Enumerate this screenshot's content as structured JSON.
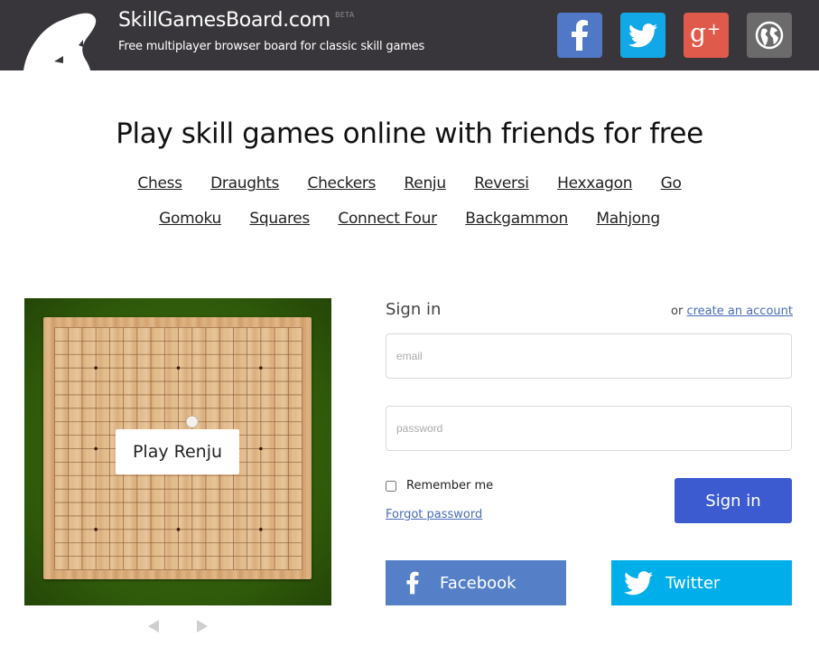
{
  "header": {
    "site_title": "SkillGamesBoard.com",
    "beta_badge": "BETA",
    "tagline": "Free multiplayer browser board for classic skill games",
    "social_links": [
      {
        "name": "facebook",
        "icon": "facebook-icon",
        "color": "#5078c6"
      },
      {
        "name": "twitter",
        "icon": "twitter-icon",
        "color": "#12a7e6"
      },
      {
        "name": "google-plus",
        "icon": "google-plus-icon",
        "color": "#e05a4b"
      },
      {
        "name": "language",
        "icon": "globe-icon",
        "color": "#6b6b6b"
      }
    ]
  },
  "hero": {
    "title": "Play skill games online with friends for free",
    "games_row1": [
      "Chess",
      "Draughts",
      "Checkers",
      "Renju",
      "Reversi",
      "Hexxagon",
      "Go"
    ],
    "games_row2": [
      "Gomoku",
      "Squares",
      "Connect Four",
      "Backgammon",
      "Mahjong"
    ]
  },
  "preview": {
    "game": "Renju",
    "play_button": "Play Renju",
    "board_size": 19,
    "star_points": [
      [
        3,
        3
      ],
      [
        9,
        3
      ],
      [
        15,
        3
      ],
      [
        3,
        9
      ],
      [
        15,
        9
      ],
      [
        3,
        15
      ],
      [
        9,
        15
      ],
      [
        15,
        15
      ]
    ],
    "stones": [
      {
        "color": "white",
        "col": 10,
        "row": 7
      }
    ],
    "prev_label": "previous",
    "next_label": "next"
  },
  "signin": {
    "title": "Sign in",
    "or_text": "or",
    "create_account_link": "create an account",
    "email_placeholder": "email",
    "email_value": "",
    "password_placeholder": "password",
    "password_value": "",
    "remember_label": "Remember me",
    "remember_checked": false,
    "forgot_link": "Forgot password",
    "submit_label": "Sign in",
    "facebook_label": "Facebook",
    "twitter_label": "Twitter",
    "colors": {
      "submit": "#3c5bd0",
      "facebook": "#5580c8",
      "twitter": "#00aeea",
      "link": "#4a6cb8"
    }
  }
}
